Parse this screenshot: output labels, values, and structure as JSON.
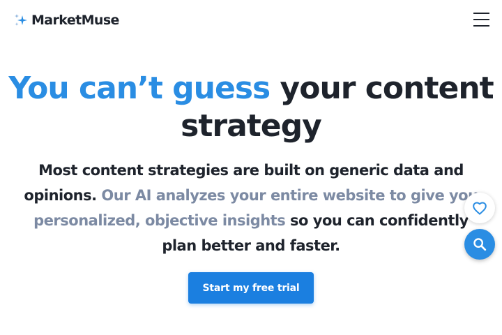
{
  "header": {
    "logo_text": "MarketMuse",
    "logo_icon": "sparkle-icon",
    "menu_icon": "hamburger-menu-icon"
  },
  "hero": {
    "title_accent": "You can’t guess",
    "title_rest": " your content strategy",
    "subtitle_part1": "Most content strategies are built on generic data and opinions. ",
    "subtitle_muted": "Our AI analyzes your entire website to give you personalized, objective insights",
    "subtitle_part2": " so you can confidently plan better and faster.",
    "cta_label": "Start my free trial"
  },
  "floating": {
    "favorite_icon": "heart-icon",
    "search_icon": "search-icon"
  },
  "colors": {
    "accent": "#2a8de3",
    "muted_text": "#7c8aa3",
    "cta_bg": "#1b7fe0",
    "text": "#1e232c"
  }
}
